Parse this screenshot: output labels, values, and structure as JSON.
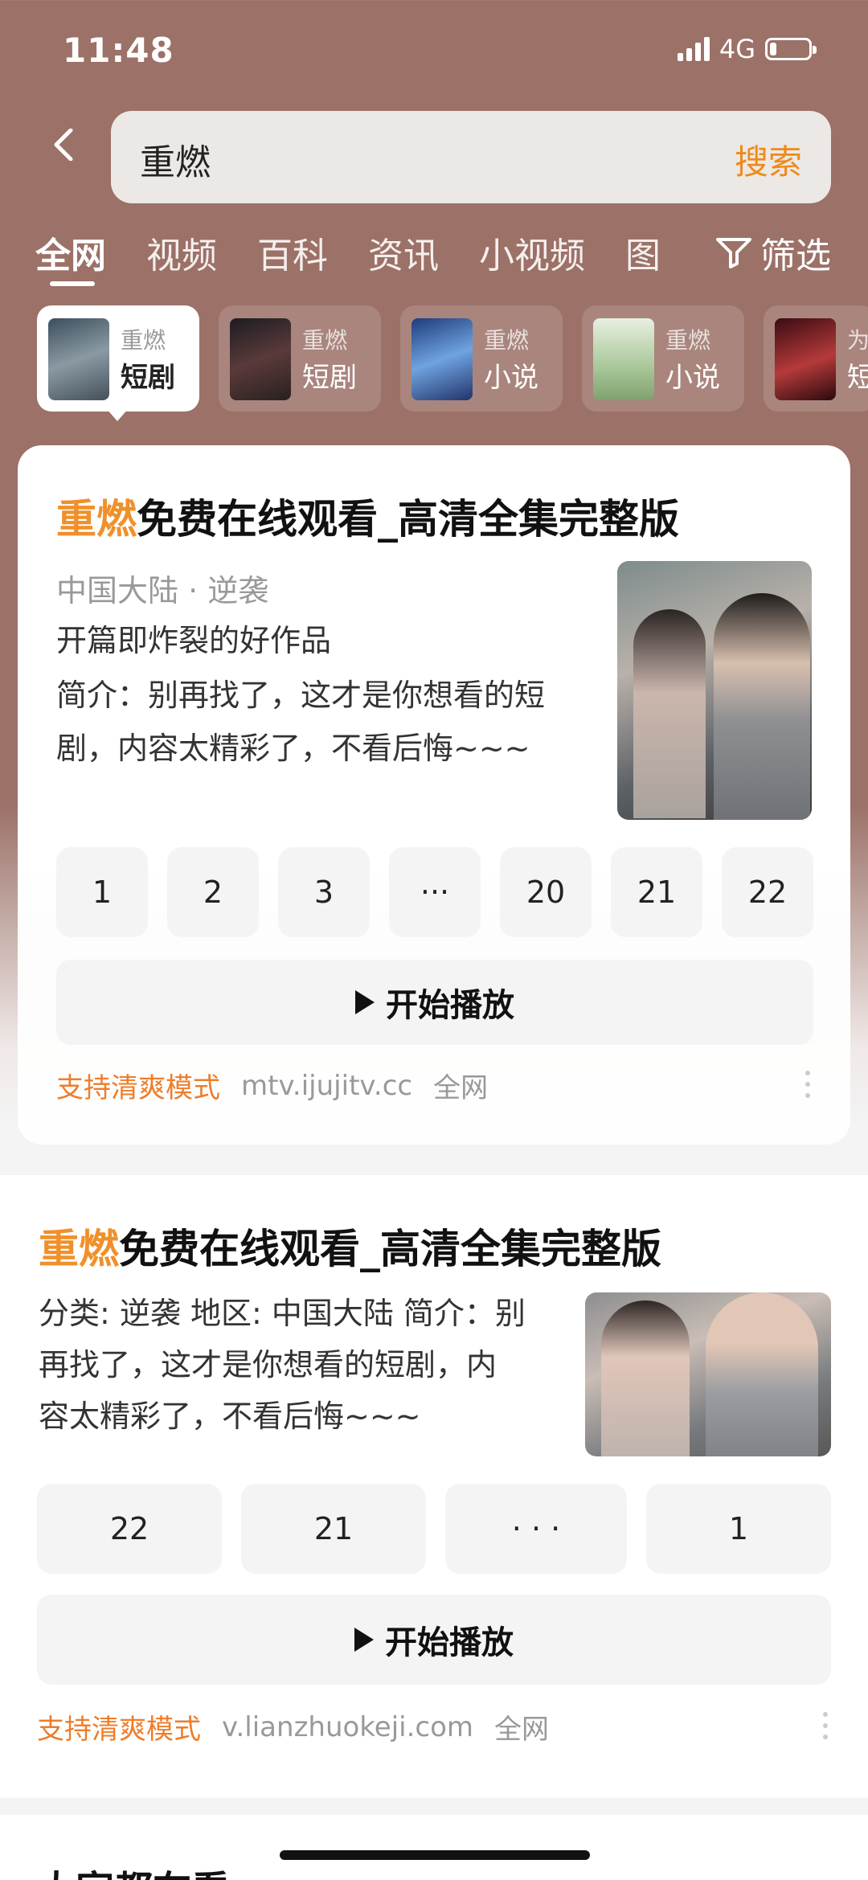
{
  "status": {
    "time": "11:48",
    "network": "4G"
  },
  "search": {
    "query": "重燃",
    "button": "搜索"
  },
  "tabs": [
    "全网",
    "视频",
    "百科",
    "资讯",
    "小视频",
    "图"
  ],
  "filter_label": "筛选",
  "chips": [
    {
      "top": "重燃",
      "bottom": "短剧"
    },
    {
      "top": "重燃",
      "bottom": "短剧"
    },
    {
      "top": "重燃",
      "bottom": "小说"
    },
    {
      "top": "重燃",
      "bottom": "小说"
    },
    {
      "top": "为",
      "bottom": "短"
    }
  ],
  "result1": {
    "title_hl": "重燃",
    "title_rest": "免费在线观看_高清全集完整版",
    "meta": "中国大陆 · 逆袭",
    "tagline": "开篇即炸裂的好作品",
    "desc_l1": "简介：别再找了，这才是你想看的短",
    "desc_l2": "剧，内容太精彩了，不看后悔~~~",
    "episodes": [
      "1",
      "2",
      "3",
      "···",
      "20",
      "21",
      "22"
    ],
    "play": "开始播放",
    "mode": "支持清爽模式",
    "domain": "mtv.ijujitv.cc",
    "scope": "全网"
  },
  "result2": {
    "title_hl": "重燃",
    "title_rest": "免费在线观看_高清全集完整版",
    "desc_l1": "分类: 逆袭 地区: 中国大陆 简介：别",
    "desc_l2": "再找了，这才是你想看的短剧，内",
    "desc_l3": "容太精彩了，不看后悔~~~",
    "episodes": [
      "22",
      "21",
      "· · ·",
      "1"
    ],
    "play": "开始播放",
    "mode": "支持清爽模式",
    "domain": "v.lianzhuokeji.com",
    "scope": "全网"
  },
  "section_next": "大家都在看"
}
